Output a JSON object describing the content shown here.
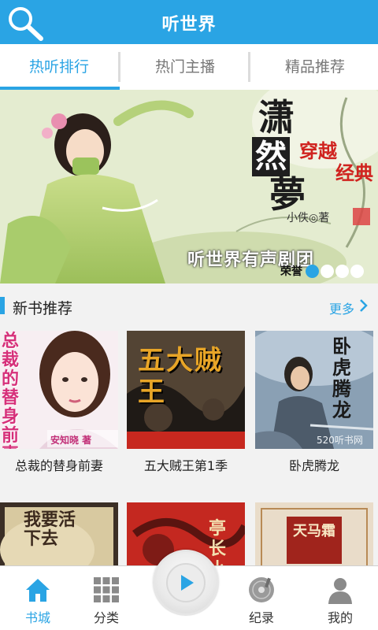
{
  "header": {
    "title": "听世界"
  },
  "tabs": [
    {
      "label": "热听排行",
      "active": true
    },
    {
      "label": "热门主播",
      "active": false
    },
    {
      "label": "精品推荐",
      "active": false
    }
  ],
  "banner": {
    "title_chars": [
      "潇",
      "然",
      "夢"
    ],
    "tag_1": "穿越",
    "tag_2": "经典",
    "author": "小佚◎著",
    "troupe": "听世界有声剧团",
    "badge": "荣誉",
    "slide_count": 4,
    "active_slide": 1
  },
  "section": {
    "title": "新书推荐",
    "more": "更多"
  },
  "books": [
    {
      "title": "总裁的替身前妻",
      "cover_text": "总裁的替身前妻",
      "cover_author": "安知晓 著"
    },
    {
      "title": "五大贼王第1季",
      "cover_text": "五大贼王"
    },
    {
      "title": "卧虎腾龙",
      "cover_text": "卧虎腾龙",
      "cover_site": "520听书网"
    },
    {
      "title": "",
      "cover_text": "我要活下去"
    },
    {
      "title": "",
      "cover_text": "亭长小"
    },
    {
      "title": "",
      "cover_text": "天马霜"
    }
  ],
  "bottom_nav": [
    {
      "label": "书城",
      "icon": "home-icon",
      "active": true
    },
    {
      "label": "分类",
      "icon": "grid-icon",
      "active": false
    },
    {
      "label": "纪录",
      "icon": "record-disc-icon",
      "active": false
    },
    {
      "label": "我的",
      "icon": "user-icon",
      "active": false
    }
  ],
  "colors": {
    "accent": "#2aa4e4",
    "red": "#d0231f"
  }
}
